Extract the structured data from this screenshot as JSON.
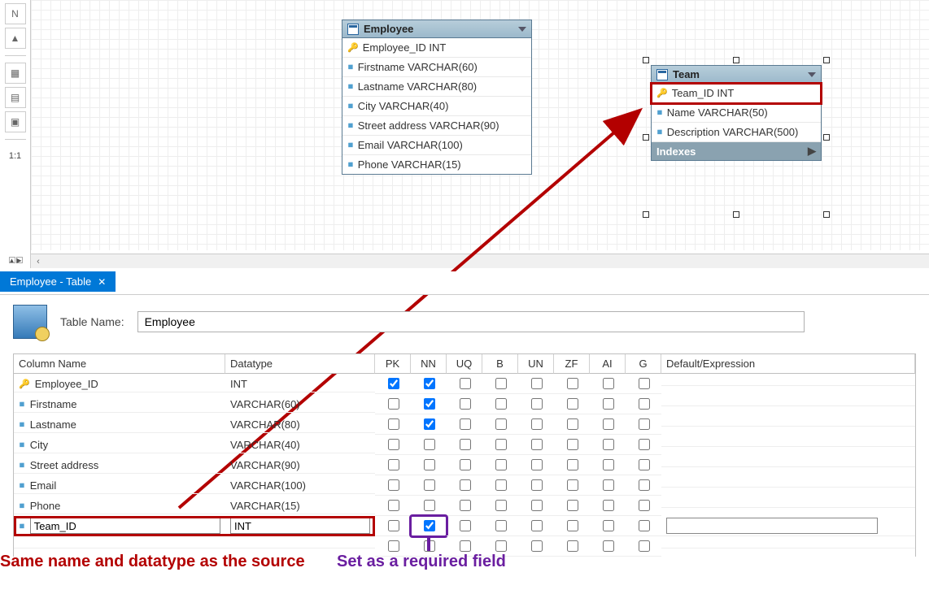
{
  "toolbar": {
    "ratio_label": "1:1"
  },
  "canvas": {
    "employee": {
      "title": "Employee",
      "rows": [
        {
          "icon": "key",
          "text": "Employee_ID INT"
        },
        {
          "icon": "dia",
          "text": "Firstname VARCHAR(60)"
        },
        {
          "icon": "dia",
          "text": "Lastname VARCHAR(80)"
        },
        {
          "icon": "dia",
          "text": "City VARCHAR(40)"
        },
        {
          "icon": "dia",
          "text": "Street address VARCHAR(90)"
        },
        {
          "icon": "dia",
          "text": "Email VARCHAR(100)"
        },
        {
          "icon": "dia",
          "text": "Phone VARCHAR(15)"
        }
      ]
    },
    "team": {
      "title": "Team",
      "rows": [
        {
          "icon": "key",
          "text": "Team_ID INT"
        },
        {
          "icon": "dia",
          "text": "Name VARCHAR(50)"
        },
        {
          "icon": "dia",
          "text": "Description VARCHAR(500)"
        }
      ],
      "section": "Indexes"
    }
  },
  "panel": {
    "tab_title": "Employee - Table",
    "table_name_label": "Table Name:",
    "table_name_value": "Employee",
    "headers": {
      "col_name": "Column Name",
      "datatype": "Datatype",
      "pk": "PK",
      "nn": "NN",
      "uq": "UQ",
      "b": "B",
      "un": "UN",
      "zf": "ZF",
      "ai": "AI",
      "g": "G",
      "default": "Default/Expression"
    },
    "rows": [
      {
        "icon": "key",
        "name": "Employee_ID",
        "datatype": "INT",
        "pk": true,
        "nn": true,
        "uq": false,
        "b": false,
        "un": false,
        "zf": false,
        "ai": false,
        "g": false,
        "default": ""
      },
      {
        "icon": "dia",
        "name": "Firstname",
        "datatype": "VARCHAR(60)",
        "pk": false,
        "nn": true,
        "uq": false,
        "b": false,
        "un": false,
        "zf": false,
        "ai": false,
        "g": false,
        "default": ""
      },
      {
        "icon": "dia",
        "name": "Lastname",
        "datatype": "VARCHAR(80)",
        "pk": false,
        "nn": true,
        "uq": false,
        "b": false,
        "un": false,
        "zf": false,
        "ai": false,
        "g": false,
        "default": ""
      },
      {
        "icon": "dia",
        "name": "City",
        "datatype": "VARCHAR(40)",
        "pk": false,
        "nn": false,
        "uq": false,
        "b": false,
        "un": false,
        "zf": false,
        "ai": false,
        "g": false,
        "default": ""
      },
      {
        "icon": "dia",
        "name": "Street address",
        "datatype": "VARCHAR(90)",
        "pk": false,
        "nn": false,
        "uq": false,
        "b": false,
        "un": false,
        "zf": false,
        "ai": false,
        "g": false,
        "default": ""
      },
      {
        "icon": "dia",
        "name": "Email",
        "datatype": "VARCHAR(100)",
        "pk": false,
        "nn": false,
        "uq": false,
        "b": false,
        "un": false,
        "zf": false,
        "ai": false,
        "g": false,
        "default": ""
      },
      {
        "icon": "dia",
        "name": "Phone",
        "datatype": "VARCHAR(15)",
        "pk": false,
        "nn": false,
        "uq": false,
        "b": false,
        "un": false,
        "zf": false,
        "ai": false,
        "g": false,
        "default": ""
      },
      {
        "icon": "dia",
        "name": "Team_ID",
        "datatype": "INT",
        "pk": false,
        "nn": true,
        "uq": false,
        "b": false,
        "un": false,
        "zf": false,
        "ai": false,
        "g": false,
        "default": "",
        "editing": true
      }
    ]
  },
  "annotations": {
    "same_source": "Same name and datatype as the source",
    "required_field": "Set as a required field"
  }
}
